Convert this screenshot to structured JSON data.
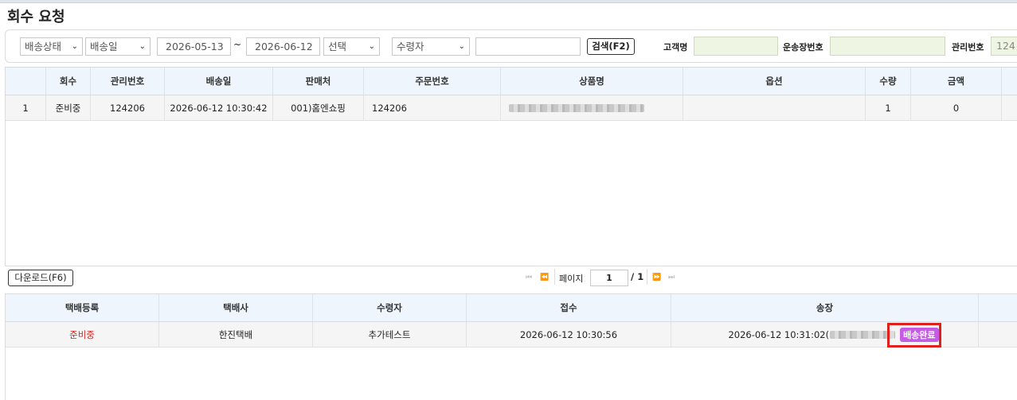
{
  "page": {
    "title": "회수 요청"
  },
  "filters": {
    "delivery_status": "배송상태",
    "date_type": "배송일",
    "date_from": "2026-05-13",
    "range_sep": "~",
    "date_to": "2026-06-12",
    "select_label": "선택",
    "receiver_select": "수령자",
    "search_value": "",
    "search_button": "검색(F2)",
    "customer_label": "고객명",
    "customer_value": "",
    "waybill_label": "운송장번호",
    "waybill_value": "",
    "mgmt_label": "관리번호",
    "mgmt_value": "124"
  },
  "top_table": {
    "headers": [
      "회수",
      "관리번호",
      "배송일",
      "판매처",
      "주문번호",
      "상품명",
      "옵션",
      "수량",
      "금액"
    ],
    "rows": [
      {
        "no": "1",
        "recall": "준비중",
        "mgmt_no": "124206",
        "ship_date": "2026-06-12 10:30:42",
        "seller": "001)홈엔쇼핑",
        "order_no": "124206",
        "product": "",
        "option": "",
        "qty": "1",
        "amount": "0"
      }
    ]
  },
  "download_button": "다운로드(F6)",
  "pager": {
    "first": "⏮",
    "prev": "⏪",
    "page_label": "페이지",
    "page_value": "1",
    "total": "/ 1",
    "next": "⏩",
    "last": "⏭"
  },
  "bottom_table": {
    "headers": [
      "택배등록",
      "택배사",
      "수령자",
      "접수",
      "송장"
    ],
    "rows": [
      {
        "reg": "준비중",
        "courier": "한진택배",
        "receiver": "추가테스트",
        "received": "2026-06-12 10:30:56",
        "invoice": "2026-06-12 10:31:02(",
        "status_badge": "배송완료"
      }
    ]
  },
  "colors": {
    "header_bg": "#eef5fc",
    "badge": "#c55ce3",
    "status_red": "#e0201c",
    "green_input": "#eef5e2"
  }
}
